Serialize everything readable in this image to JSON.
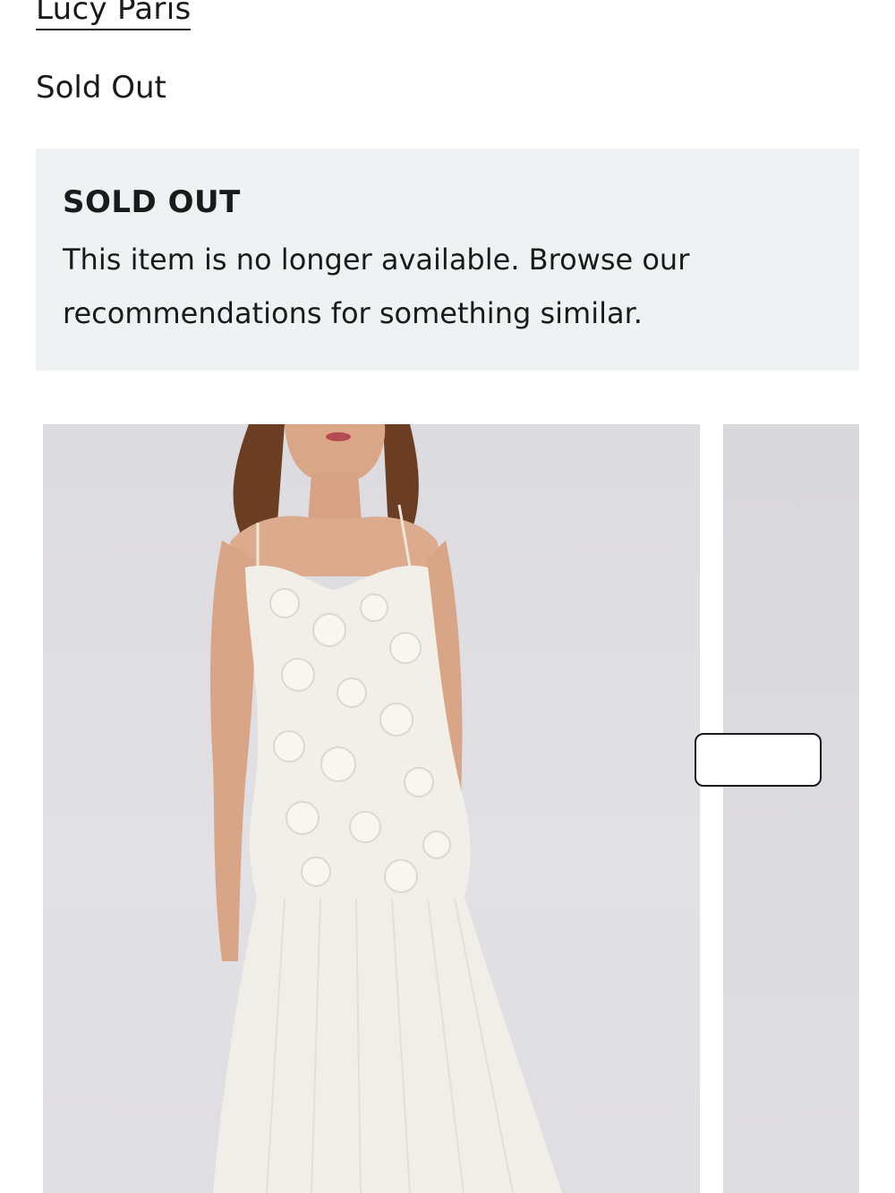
{
  "product": {
    "brand": "Lucy Paris",
    "price_status": "Sold Out"
  },
  "notice": {
    "title": "SOLD OUT",
    "message": "This item is no longer available. Browse our recommendations for something similar."
  },
  "gallery": {
    "image_description": "model-wearing-white-floral-appliqué-maxi-dress"
  },
  "colors": {
    "text": "#191a1b",
    "notice_bg": "#eff2f3",
    "photo_bg": "#dfdee2"
  }
}
